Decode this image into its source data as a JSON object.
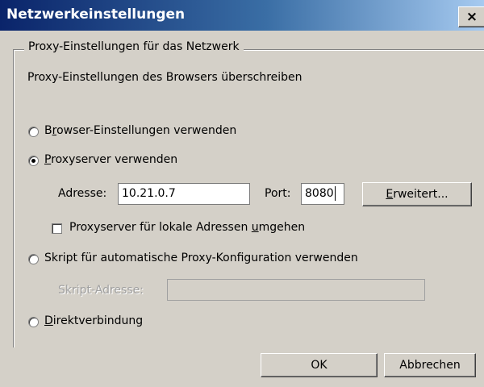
{
  "window": {
    "title": "Netzwerkeinstellungen",
    "close_label": "×"
  },
  "group": {
    "legend": "Proxy-Einstellungen für das Netzwerk",
    "description": "Proxy-Einstellungen des Browsers überschreiben"
  },
  "options": {
    "browser": {
      "access_key": "r",
      "before": "B",
      "after": "owser-Einstellungen verwenden",
      "selected": false
    },
    "proxy": {
      "access_key": "P",
      "before": "",
      "after": "roxyserver verwenden",
      "selected": true
    },
    "script": {
      "access_key": "",
      "before": "",
      "after": "Skript für automatische Proxy-Konfiguration verwenden",
      "selected": false
    },
    "direct": {
      "access_key": "D",
      "before": "",
      "after": "irektverbindung",
      "selected": false
    }
  },
  "proxy": {
    "address_label": "Adresse:",
    "address_value": "10.21.0.7",
    "port_label": "Port:",
    "port_value": "8080",
    "advanced": {
      "access_key": "E",
      "rest": "rweitert..."
    },
    "bypass": {
      "before": "Proxyserver für lokale Adressen ",
      "access_key": "u",
      "after": "mgehen",
      "checked": false
    }
  },
  "script": {
    "address_label": "Skript-Adresse:",
    "address_value": ""
  },
  "buttons": {
    "ok": "OK",
    "cancel": "Abbrechen"
  }
}
